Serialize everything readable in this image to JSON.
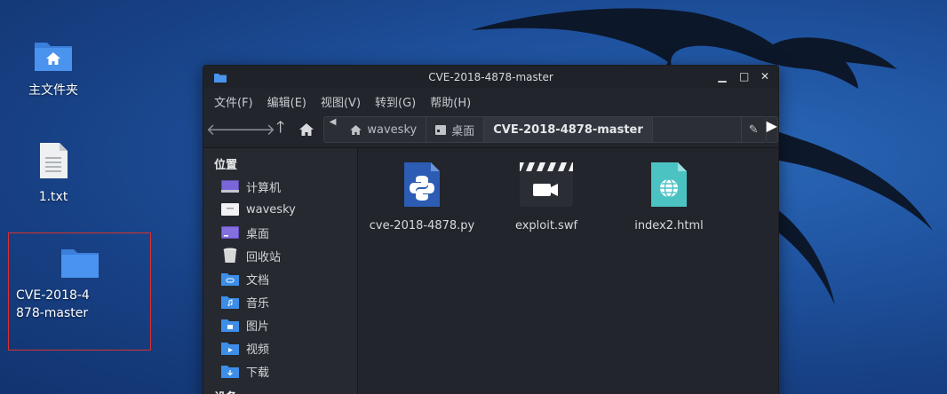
{
  "desktop": {
    "icons": [
      {
        "label": "主文件夹",
        "icon": "home-folder-icon"
      },
      {
        "label": "1.txt",
        "icon": "text-file-icon"
      },
      {
        "label_line1": "CVE-2018-4",
        "label_line2": "878-master",
        "icon": "folder-icon"
      }
    ]
  },
  "window": {
    "title": "CVE-2018-4878-master",
    "controls": {
      "minimize": "▁",
      "maximize": "□",
      "close": "✕"
    },
    "menu": [
      "文件(F)",
      "编辑(E)",
      "视图(V)",
      "转到(G)",
      "帮助(H)"
    ],
    "path": {
      "home": "wavesky",
      "desktop": "桌面",
      "current": "CVE-2018-4878-master"
    },
    "sidebar": {
      "places_title": "位置",
      "items": [
        "计算机",
        "wavesky",
        "桌面",
        "回收站",
        "文档",
        "音乐",
        "图片",
        "视频",
        "下载"
      ],
      "devices_title": "设备"
    },
    "files": [
      {
        "name": "cve-2018-4878.py",
        "icon": "python-file-icon"
      },
      {
        "name": "exploit.swf",
        "icon": "video-file-icon"
      },
      {
        "name": "index2.html",
        "icon": "html-file-icon"
      }
    ]
  },
  "colors": {
    "accent": "#3d8ee8",
    "selection_border": "#d9322e",
    "window_bg": "#22252c"
  }
}
